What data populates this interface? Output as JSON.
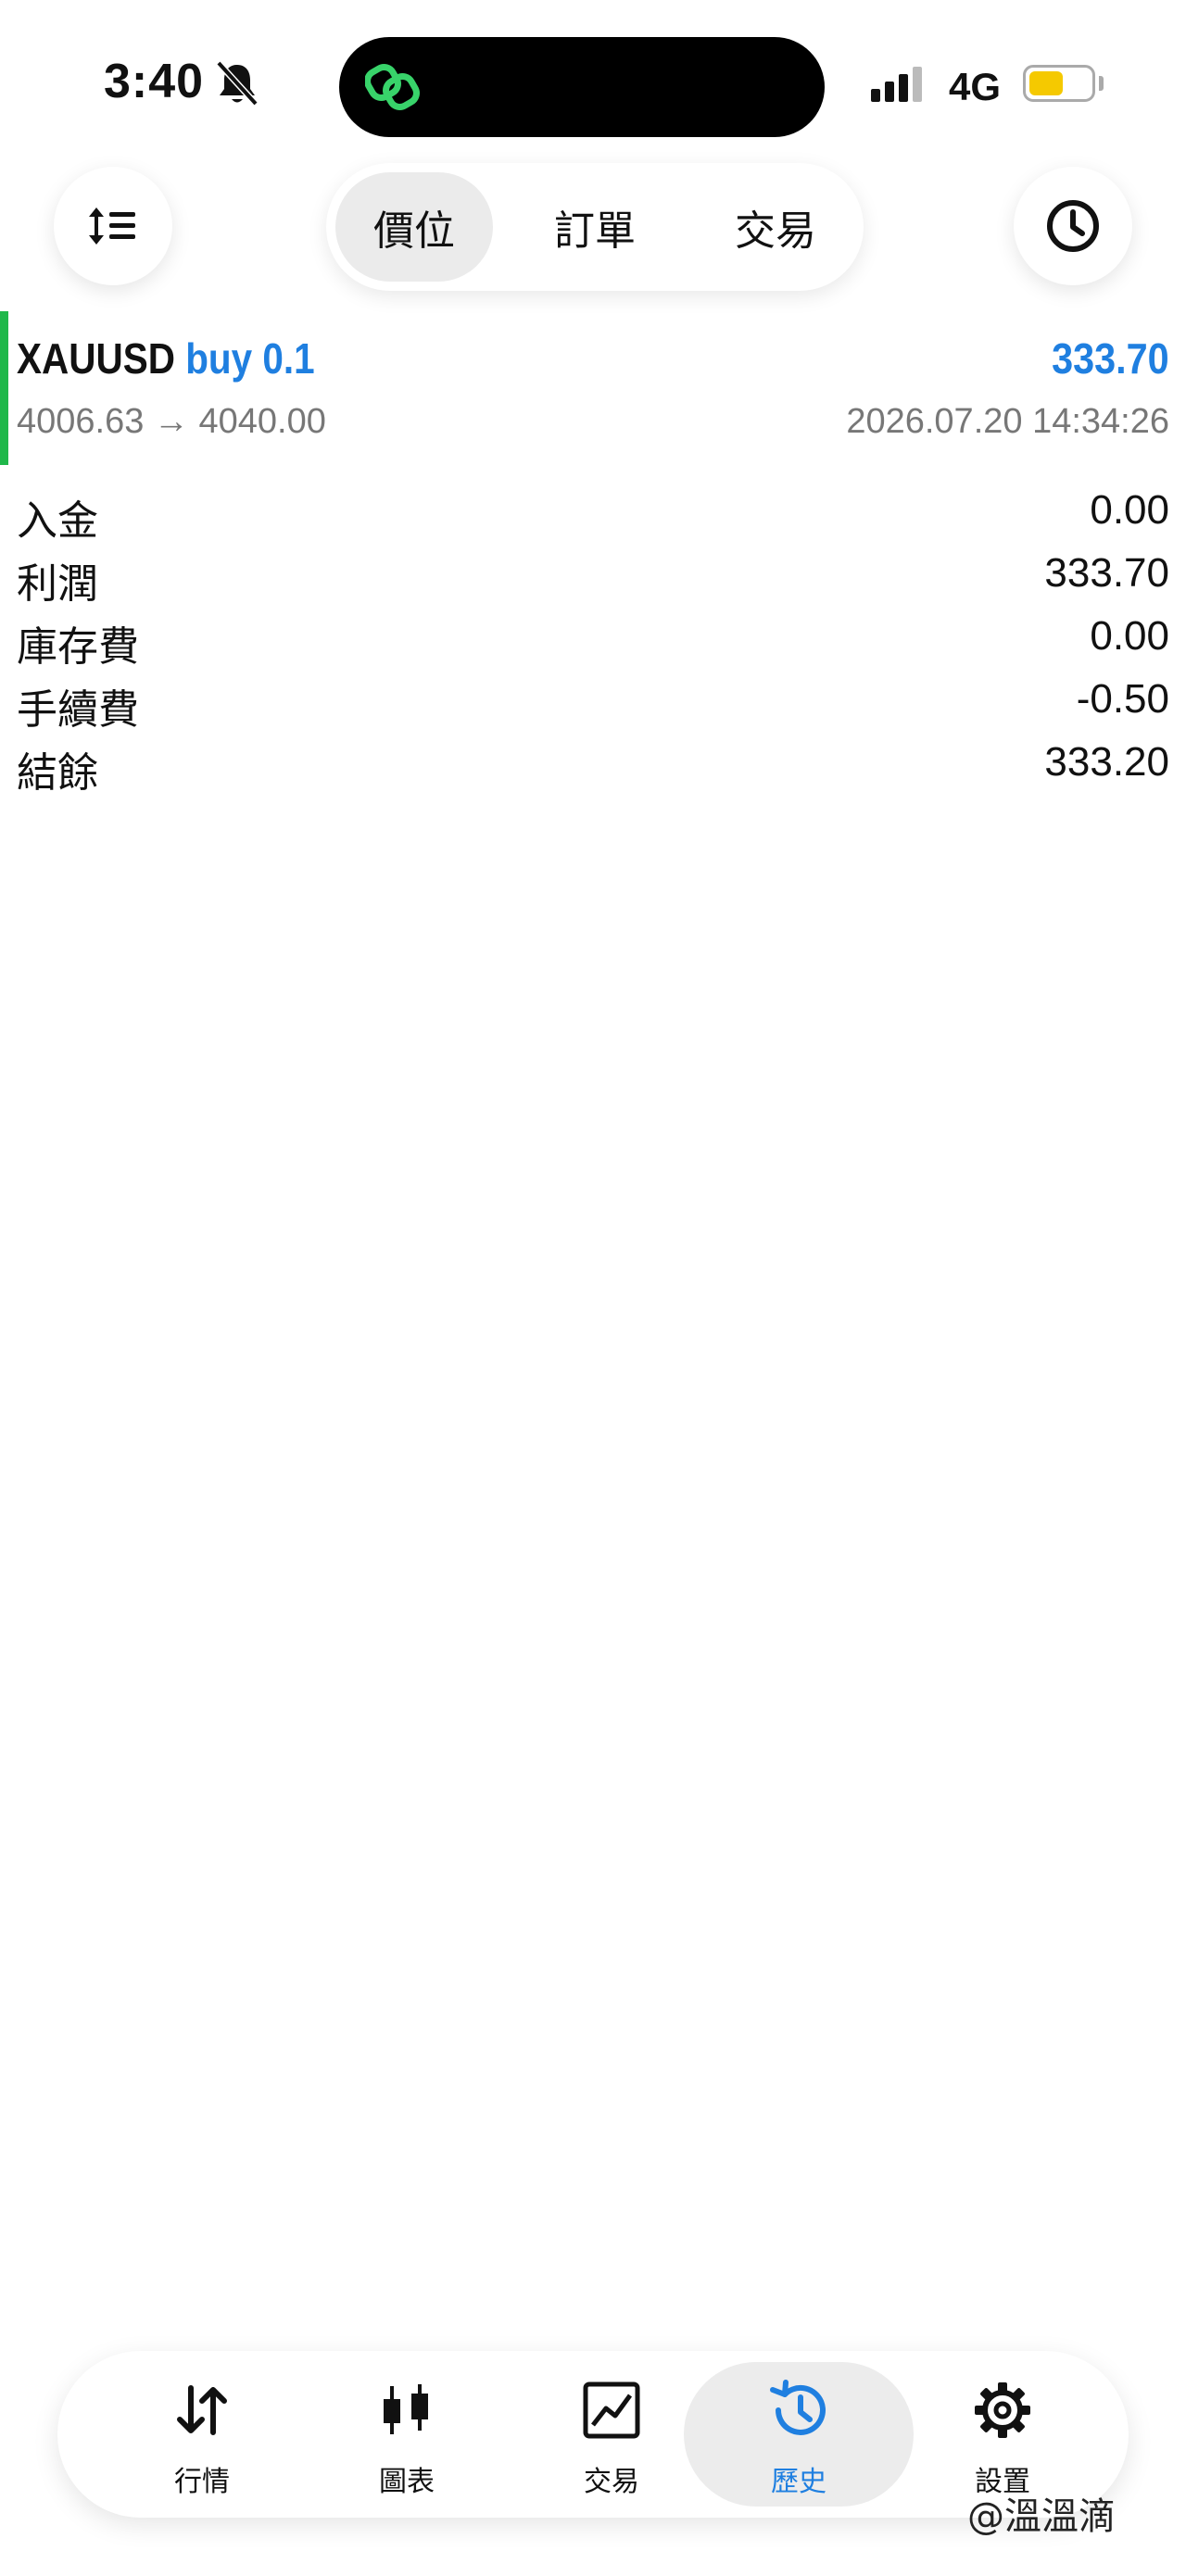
{
  "status_bar": {
    "time": "3:40",
    "network": "4G",
    "battery_color": "#f5c900"
  },
  "header": {
    "left_icon": "sort-icon",
    "right_icon": "clock-icon",
    "tabs": [
      {
        "label": "價位",
        "active": true
      },
      {
        "label": "訂單",
        "active": false
      },
      {
        "label": "交易",
        "active": false
      }
    ]
  },
  "trade": {
    "symbol": "XAUUSD",
    "side_volume": "buy 0.1",
    "profit": "333.70",
    "price_range": "4006.63 → 4040.00",
    "datetime": "2026.07.20 14:34:26",
    "accent_color": "#1f7fe0",
    "bar_color": "#1fb84a"
  },
  "summary": [
    {
      "label": "入金",
      "value": "0.00"
    },
    {
      "label": "利潤",
      "value": "333.70"
    },
    {
      "label": "庫存費",
      "value": "0.00"
    },
    {
      "label": "手續費",
      "value": "-0.50"
    },
    {
      "label": "結餘",
      "value": "333.20"
    }
  ],
  "bottom_nav": [
    {
      "label": "行情",
      "icon": "quotes-arrows-icon",
      "active": false
    },
    {
      "label": "圖表",
      "icon": "candlestick-chart-icon",
      "active": false
    },
    {
      "label": "交易",
      "icon": "trade-chart-icon",
      "active": false
    },
    {
      "label": "歷史",
      "icon": "history-icon",
      "active": true
    },
    {
      "label": "設置",
      "icon": "gear-icon",
      "active": false
    }
  ],
  "watermark": "@溫溫滴"
}
